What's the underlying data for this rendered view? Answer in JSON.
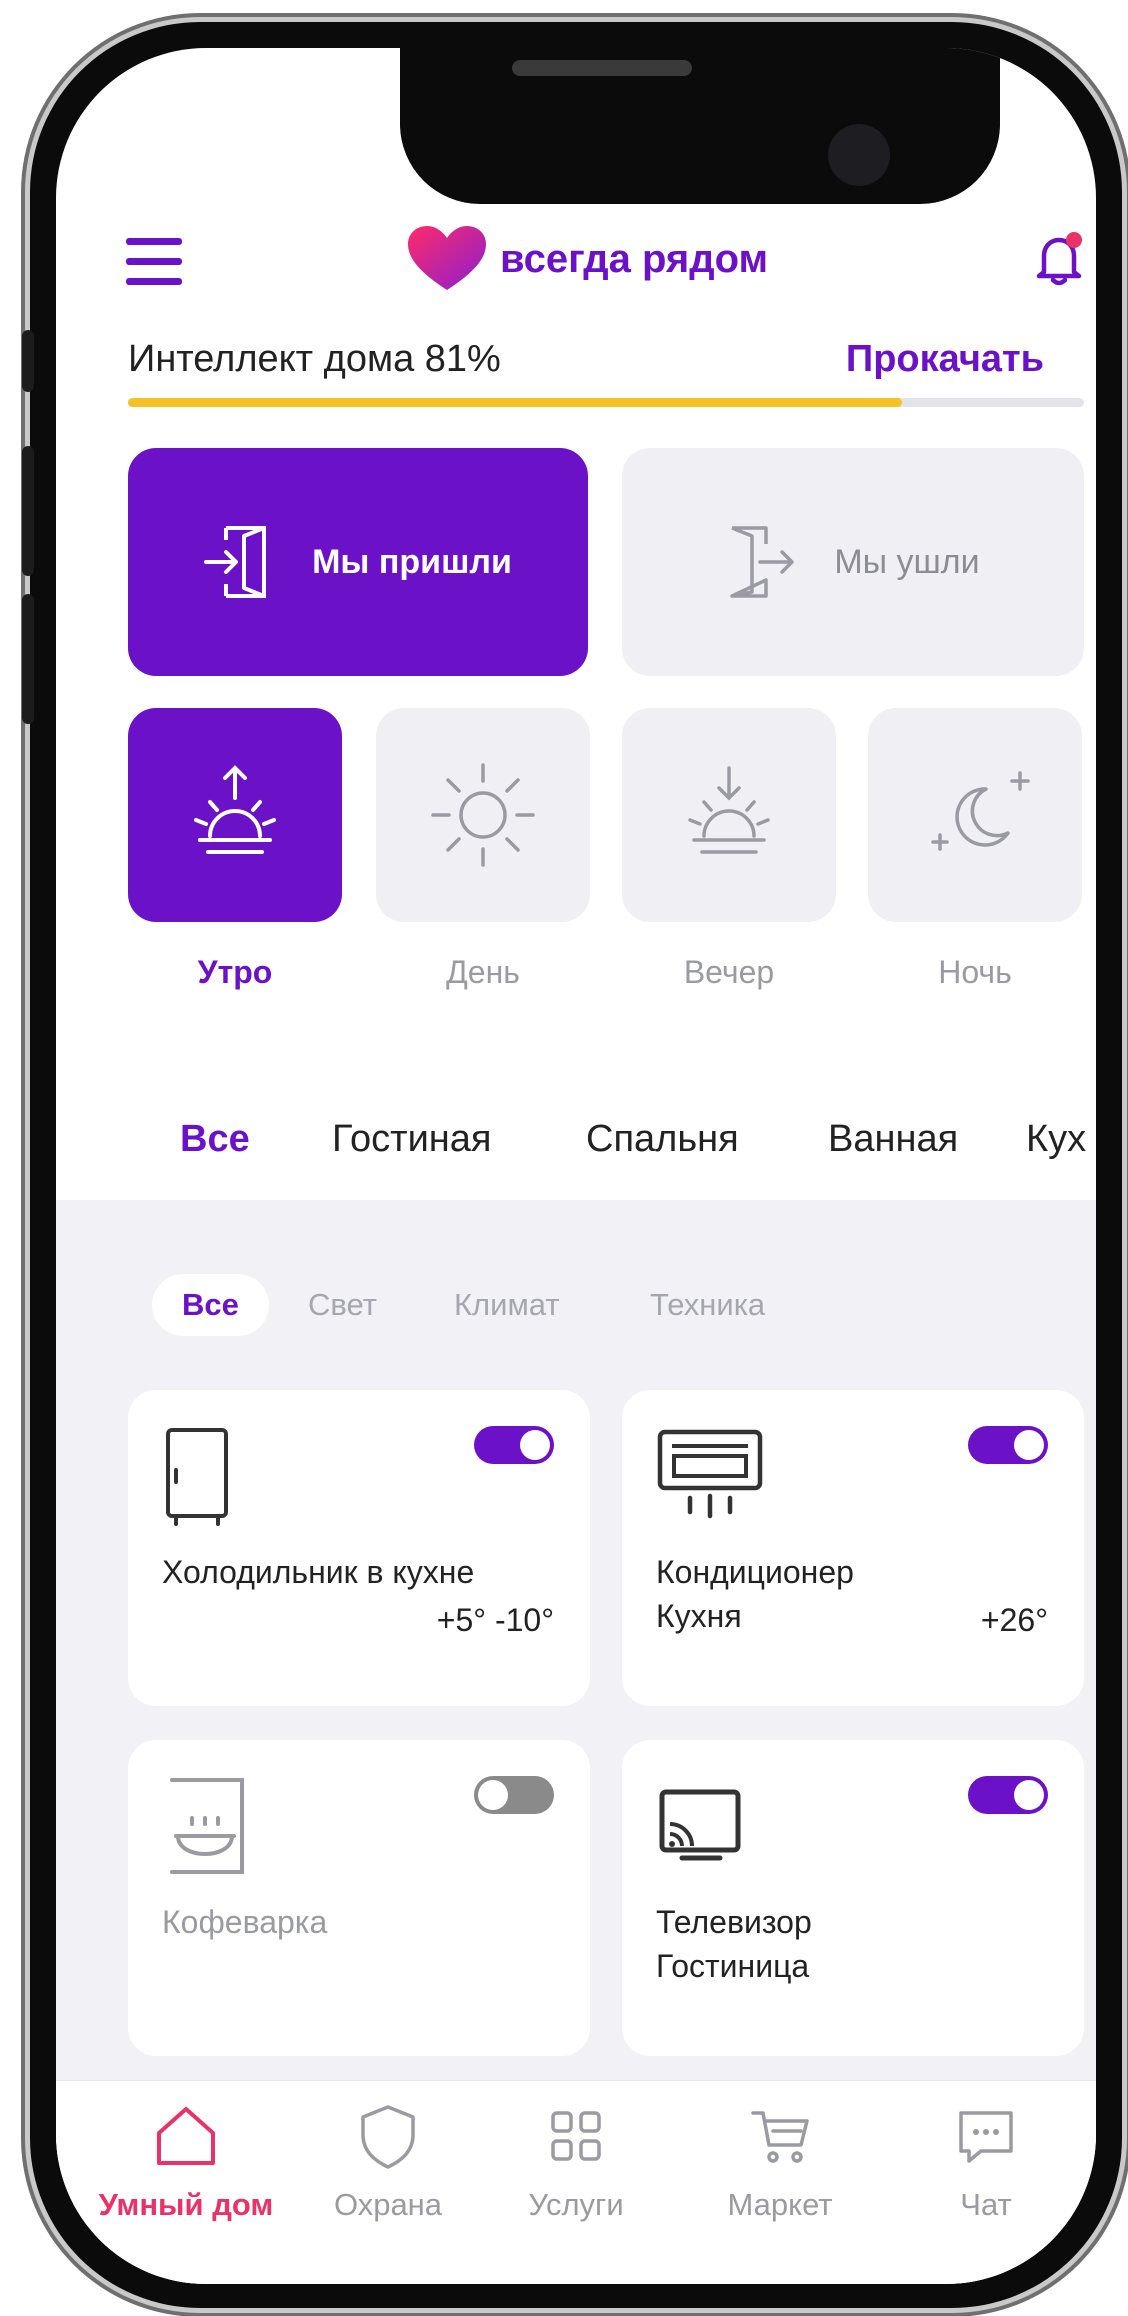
{
  "app": {
    "brand": "всегда рядом"
  },
  "colors": {
    "accent": "#6b12c9",
    "progress": "#f5c225",
    "nav_active": "#e83268"
  },
  "intellect": {
    "label": "Интеллект дома 81%",
    "progress_fraction": 0.81,
    "upgrade_label": "Прокачать"
  },
  "scenes": [
    {
      "label": "Мы пришли",
      "active": true,
      "icon": "door-enter-icon"
    },
    {
      "label": "Мы ушли",
      "active": false,
      "icon": "door-exit-icon"
    }
  ],
  "time_of_day": [
    {
      "label": "Утро",
      "active": true,
      "icon": "sunrise-icon"
    },
    {
      "label": "День",
      "active": false,
      "icon": "sun-icon"
    },
    {
      "label": "Вечер",
      "active": false,
      "icon": "sunset-icon"
    },
    {
      "label": "Ночь",
      "active": false,
      "icon": "moon-icon"
    }
  ],
  "rooms": [
    "Все",
    "Гостиная",
    "Спальня",
    "Ванная",
    "Кух"
  ],
  "categories": [
    "Все",
    "Свет",
    "Климат",
    "Техника"
  ],
  "devices": [
    {
      "name": "Холодильник в кухне",
      "temp": "+5° -10°",
      "on": true,
      "icon": "fridge-icon"
    },
    {
      "name": "Кондиционер\nКухня",
      "temp": "+26°",
      "on": true,
      "icon": "air-conditioner-icon"
    },
    {
      "name": "Кофеварка",
      "temp": "",
      "on": false,
      "icon": "coffee-maker-icon"
    },
    {
      "name": "Телевизор\nГостиница",
      "temp": "",
      "on": true,
      "icon": "tv-cast-icon"
    }
  ],
  "nav": [
    {
      "label": "Умный дом",
      "active": true,
      "icon": "home-icon"
    },
    {
      "label": "Охрана",
      "active": false,
      "icon": "shield-icon"
    },
    {
      "label": "Услуги",
      "active": false,
      "icon": "grid-icon"
    },
    {
      "label": "Маркет",
      "active": false,
      "icon": "cart-icon"
    },
    {
      "label": "Чат",
      "active": false,
      "icon": "chat-icon"
    }
  ]
}
